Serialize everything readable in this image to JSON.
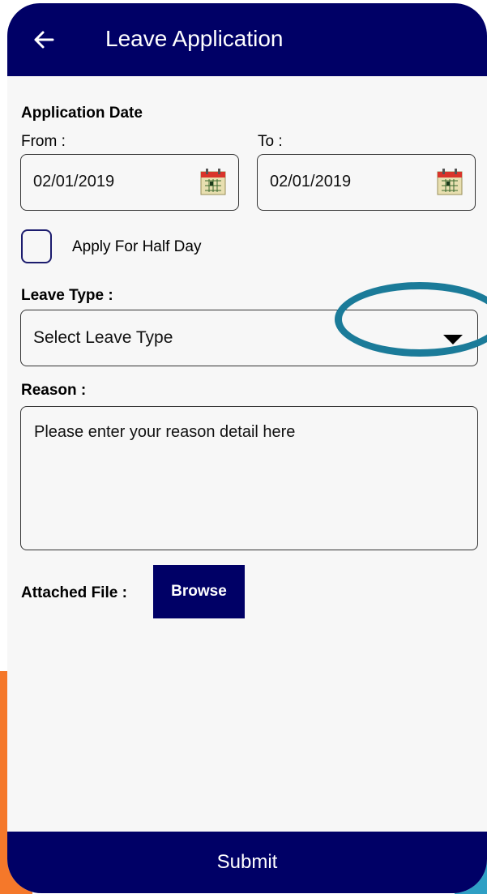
{
  "appbar": {
    "title": "Leave Application",
    "back_icon": "arrow-left-icon"
  },
  "form": {
    "application_date_label": "Application Date",
    "from_label": "From :",
    "to_label": "To :",
    "from_date": "02/01/2019",
    "to_date": "02/01/2019",
    "calendar_icon": "calendar-icon",
    "half_day_label": "Apply For Half Day",
    "half_day_checked": false,
    "leave_type_label": "Leave Type :",
    "leave_type_selected": "Select Leave Type",
    "reason_label": "Reason :",
    "reason_placeholder": "Please enter your reason detail here",
    "attached_file_label": "Attached File :",
    "browse_label": "Browse"
  },
  "footer": {
    "submit_label": "Submit"
  },
  "colors": {
    "primary": "#000066",
    "highlight_ring": "#1b7b99",
    "accent_orange": "#f5782a",
    "accent_teal": "#2e9fc4"
  }
}
